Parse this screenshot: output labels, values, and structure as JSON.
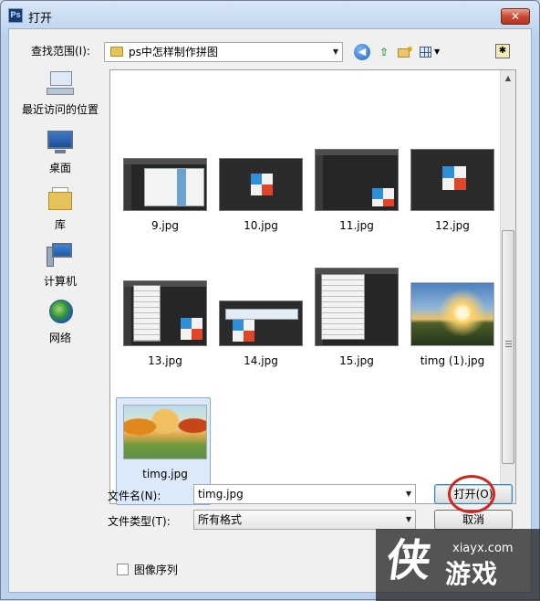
{
  "window": {
    "app_icon": "ps-icon",
    "title": "打开",
    "close_label": "✕"
  },
  "toolbar": {
    "lookin_label": "查找范围(I):",
    "lookin_value": "ps中怎样制作拼图",
    "buttons": [
      "back-icon",
      "up-folder-icon",
      "new-folder-icon",
      "view-menu-icon"
    ]
  },
  "places": [
    {
      "label": "最近访问的位置",
      "icon": "recent-places-icon"
    },
    {
      "label": "桌面",
      "icon": "desktop-icon"
    },
    {
      "label": "库",
      "icon": "library-icon"
    },
    {
      "label": "计算机",
      "icon": "computer-icon"
    },
    {
      "label": "网络",
      "icon": "network-icon"
    }
  ],
  "files": [
    {
      "name": "9.jpg"
    },
    {
      "name": "10.jpg"
    },
    {
      "name": "11.jpg"
    },
    {
      "name": "12.jpg"
    },
    {
      "name": "13.jpg"
    },
    {
      "name": "14.jpg"
    },
    {
      "name": "15.jpg"
    },
    {
      "name": "timg (1).jpg"
    },
    {
      "name": "timg.jpg",
      "selected": true
    }
  ],
  "form": {
    "filename_label": "文件名(N):",
    "filename_value": "timg.jpg",
    "filetype_label": "文件类型(T):",
    "filetype_value": "所有格式",
    "open_button": "打开(O)",
    "cancel_button": "取消",
    "sequence_checkbox_label": "图像序列",
    "sequence_checked": false
  },
  "watermark": {
    "logo": "侠",
    "url": "xiayx.com",
    "name": "游戏"
  },
  "colors": {
    "annotation_circle": "#d0261f",
    "selection": "#dbe9fb",
    "close_button": "#c94a34"
  }
}
